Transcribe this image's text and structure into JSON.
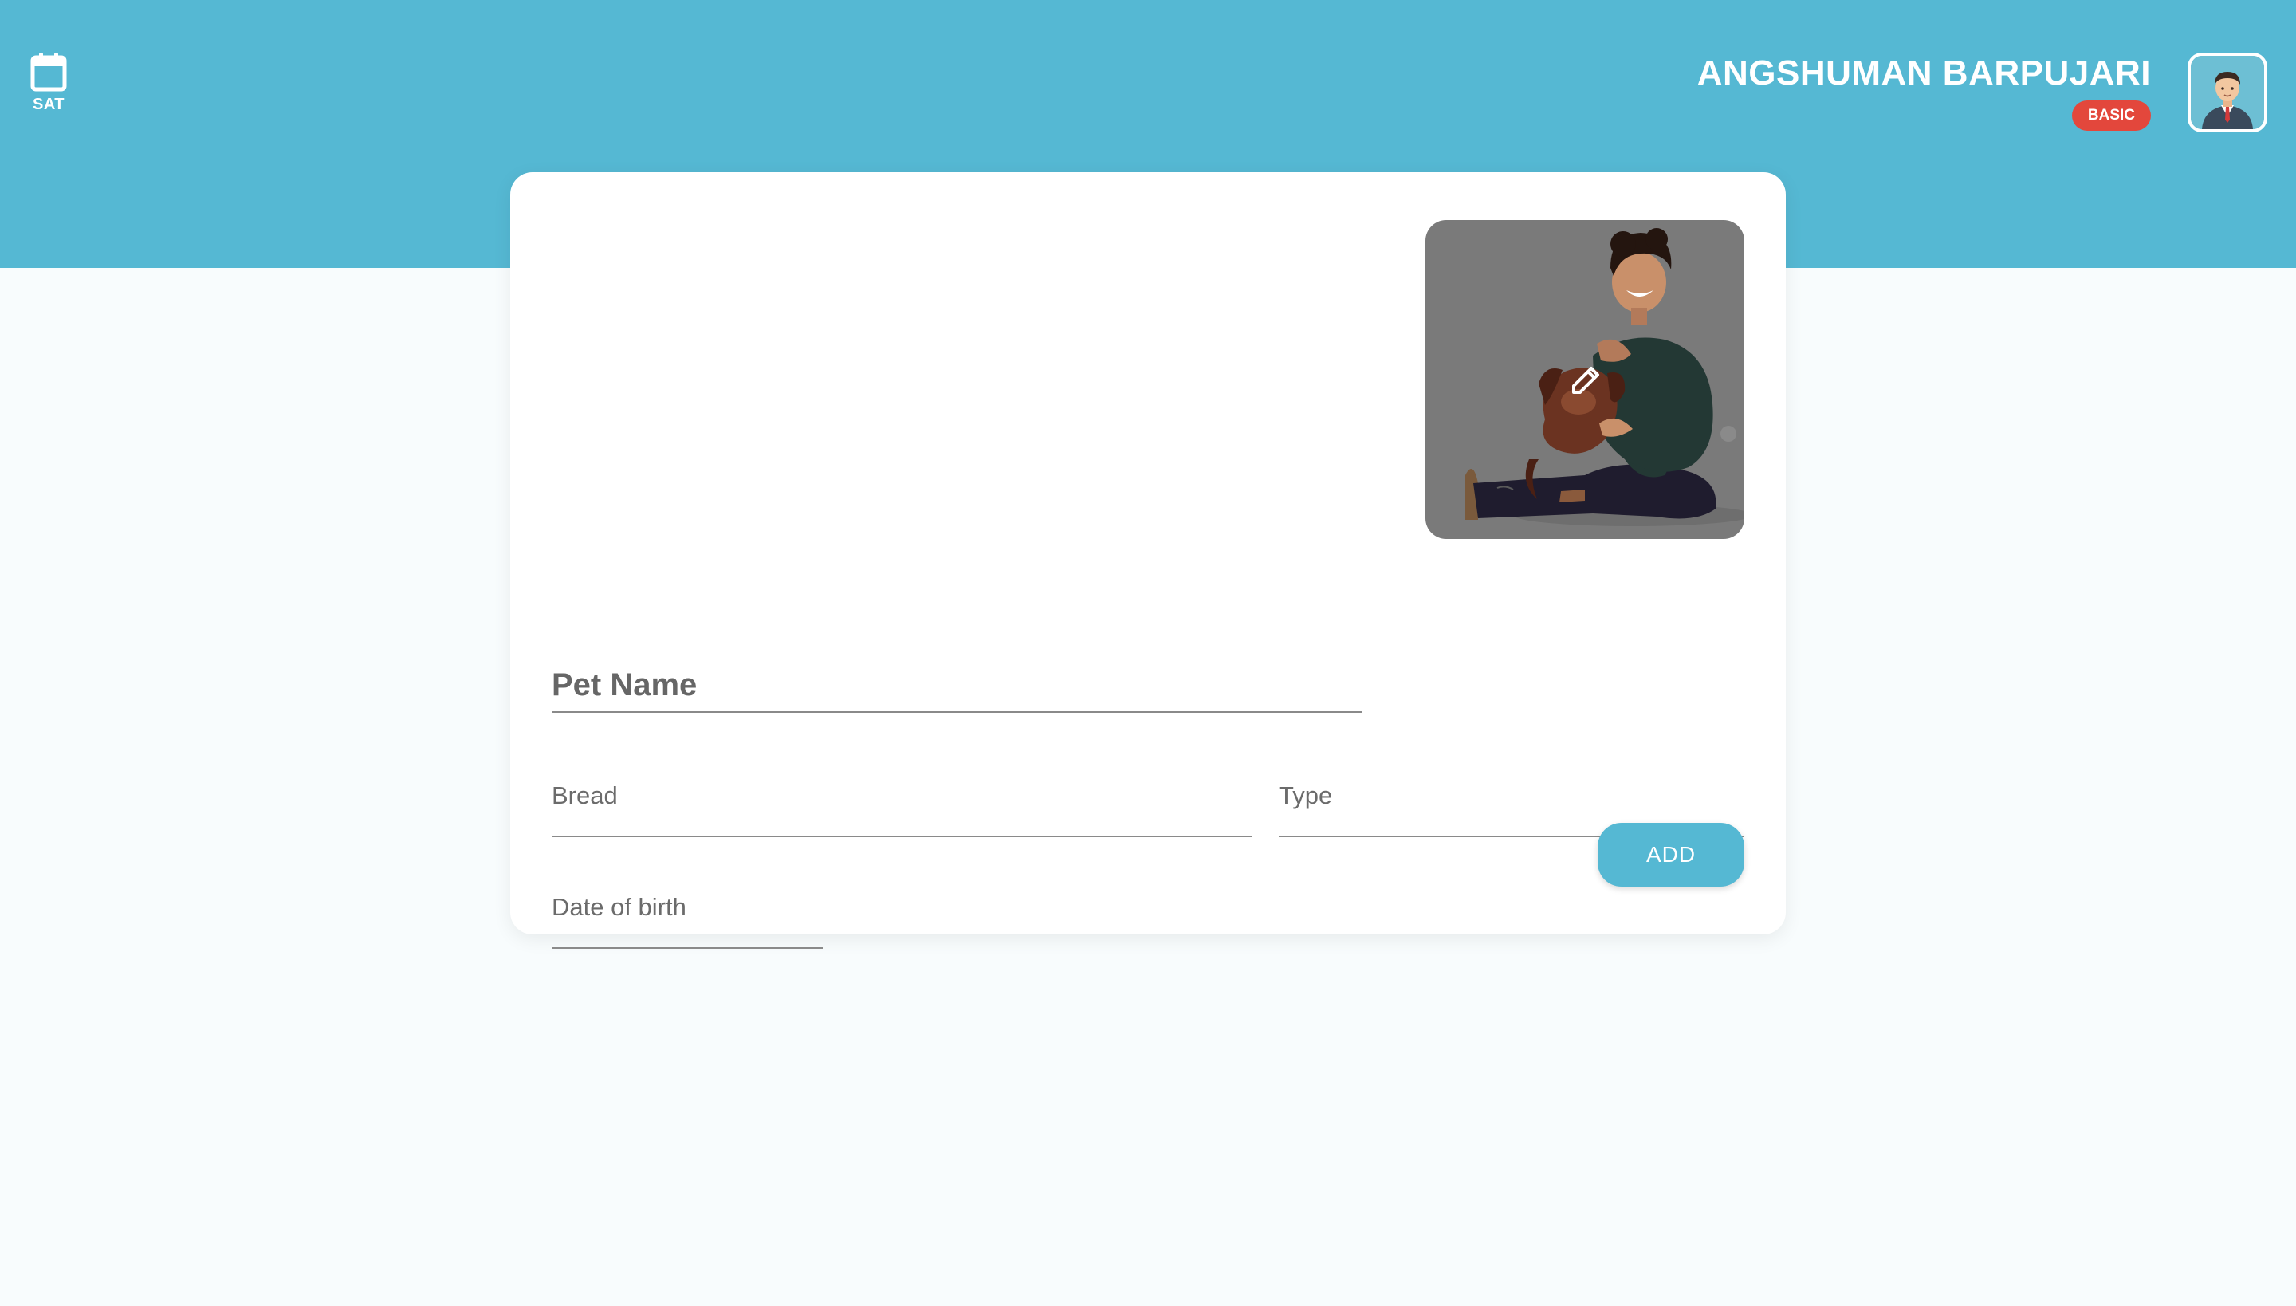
{
  "header": {
    "day_label": "SAT",
    "user_name": "ANGSHUMAN BARPUJARI",
    "plan_badge": "BASIC"
  },
  "form": {
    "pet_name_label": "Pet Name",
    "breed_label": "Bread",
    "type_label": "Type",
    "dob_label": "Date of birth",
    "add_label": "ADD"
  },
  "colors": {
    "header_bg": "#55b8d3",
    "page_bg": "#f8fcfd",
    "badge": "#e3473c",
    "button": "#55b8d3"
  },
  "icons": {
    "date": "calendar-icon",
    "photo_edit": "pencil-icon",
    "avatar": "user-avatar-icon"
  }
}
